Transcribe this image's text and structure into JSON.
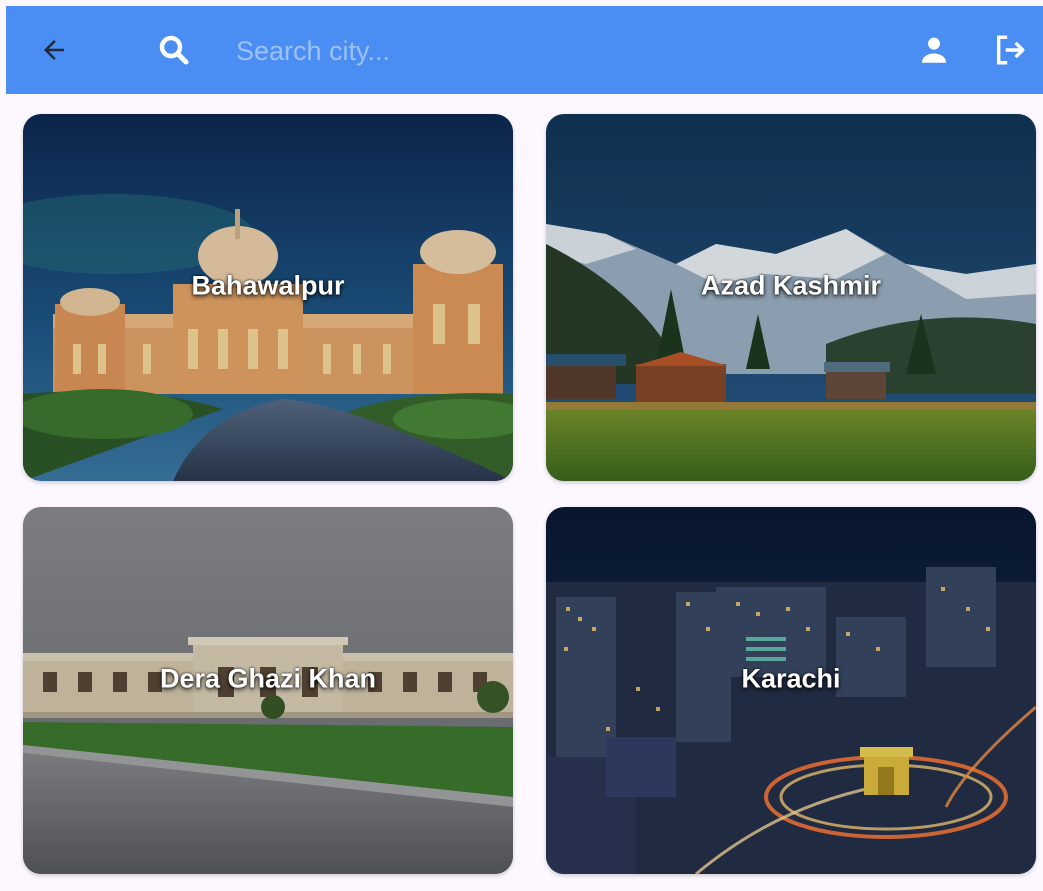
{
  "appbar": {
    "back_icon": "arrow-left-icon",
    "search_icon": "search-icon",
    "search_placeholder": "Search city...",
    "search_value": "",
    "profile_icon": "person-icon",
    "logout_icon": "logout-icon",
    "background_color": "#4b8ef3"
  },
  "cities": [
    {
      "name": "Bahawalpur",
      "scene": "palace"
    },
    {
      "name": "Azad Kashmir",
      "scene": "mountains"
    },
    {
      "name": "Dera Ghazi Khan",
      "scene": "building"
    },
    {
      "name": "Karachi",
      "scene": "night-city"
    }
  ]
}
